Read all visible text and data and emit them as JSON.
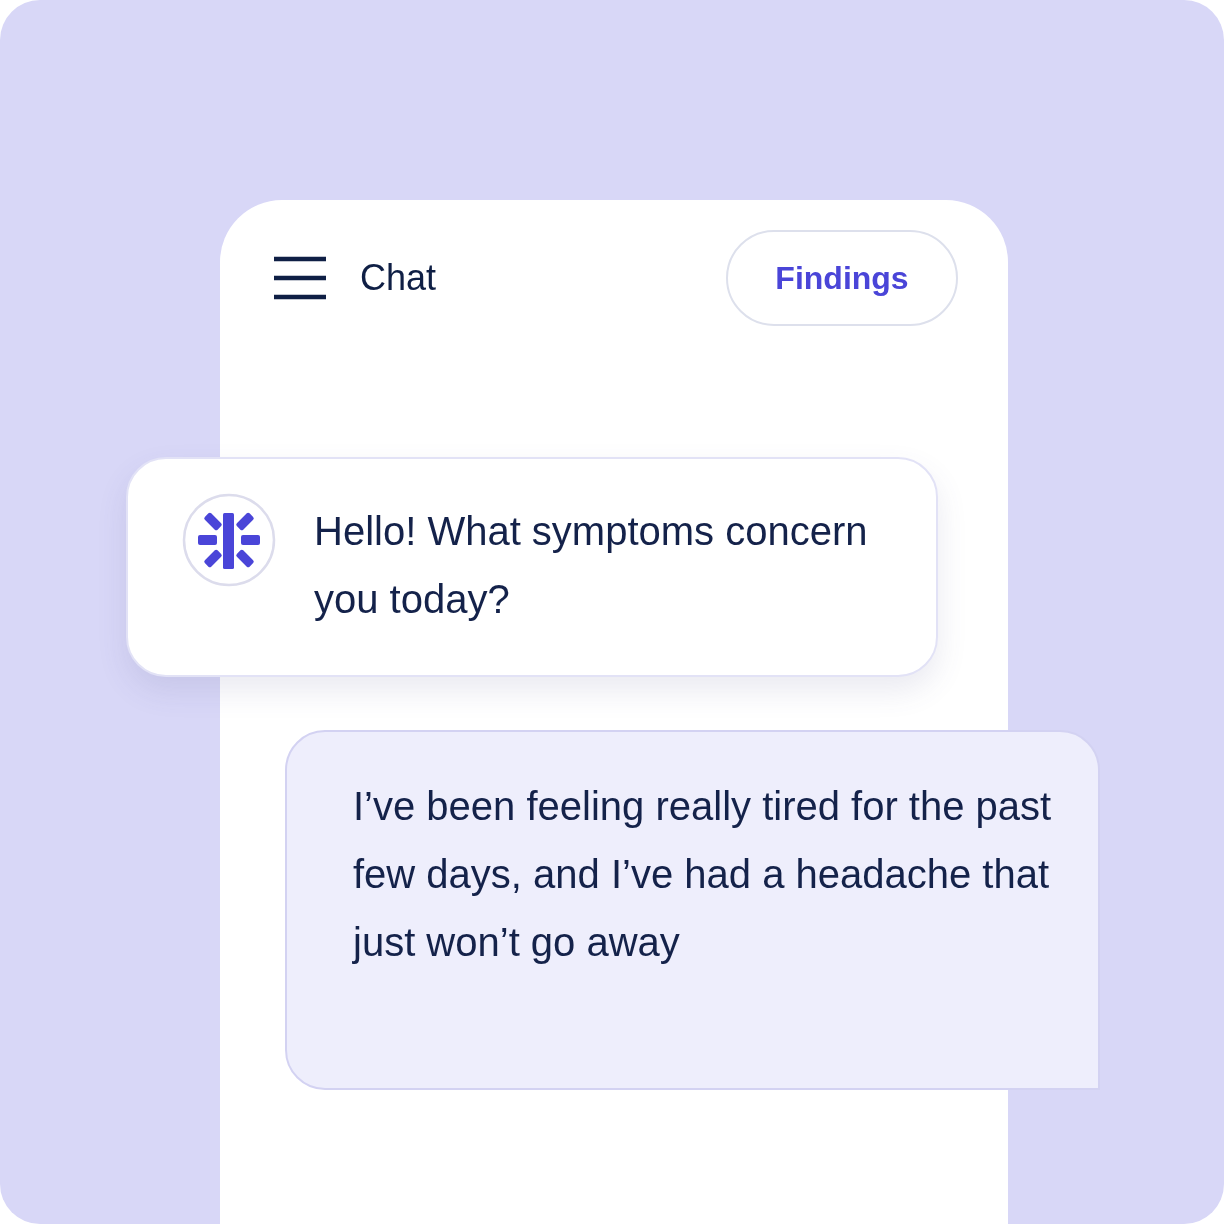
{
  "header": {
    "title": "Chat",
    "button": "Findings"
  },
  "messages": [
    {
      "kind": "bot",
      "text": "Hello! What symptoms concern you today?"
    },
    {
      "kind": "user",
      "text": "I’ve been feeling really tired for the past few days, and I’ve had a headache that just won’t go away"
    }
  ]
}
